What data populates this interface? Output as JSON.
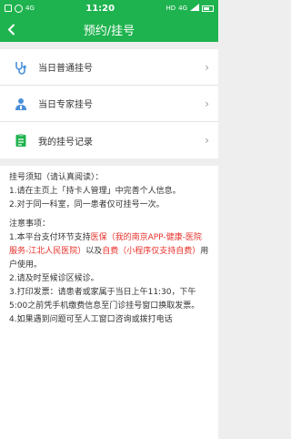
{
  "status_bar": {
    "time": "11:20",
    "signal_left": "4G",
    "signal_right": "4G",
    "network_type": "HD"
  },
  "header": {
    "title": "预约/挂号"
  },
  "menu": [
    {
      "label": "当日普通挂号",
      "icon": "stethoscope-icon"
    },
    {
      "label": "当日专家挂号",
      "icon": "doctor-icon"
    },
    {
      "label": "我的挂号记录",
      "icon": "clipboard-icon"
    }
  ],
  "notes": {
    "section1_title": "挂号须知（请认真阅读）：",
    "section1_item1": "1.请在主页上「持卡人管理」中完善个人信息。",
    "section1_item2": "2.对于同一科室，同一患者仅可挂号一次。",
    "section2_title": "注意事项：",
    "section2_item1_prefix": "1.本平台支付环节支持",
    "section2_item1_red1": "医保（我的南京APP-健康-医院服务-江北人民医院）",
    "section2_item1_mid": "以及",
    "section2_item1_red2": "自费（小程序仅支持自费）",
    "section2_item1_suffix": "用户使用。",
    "section2_item2": "2.请及时至候诊区候诊。",
    "section2_item3": "3.打印发票：请患者或家属于当日上午11:30，下午5:00之前凭手机缴费信息至门诊挂号窗口换取发票。",
    "section2_item4": "4.如果遇到问题可至人工窗口咨询或拨打电话"
  },
  "colors": {
    "brand_green": "#1fb34f",
    "warning_red": "#e8312b",
    "icon_blue": "#4a90d9"
  }
}
